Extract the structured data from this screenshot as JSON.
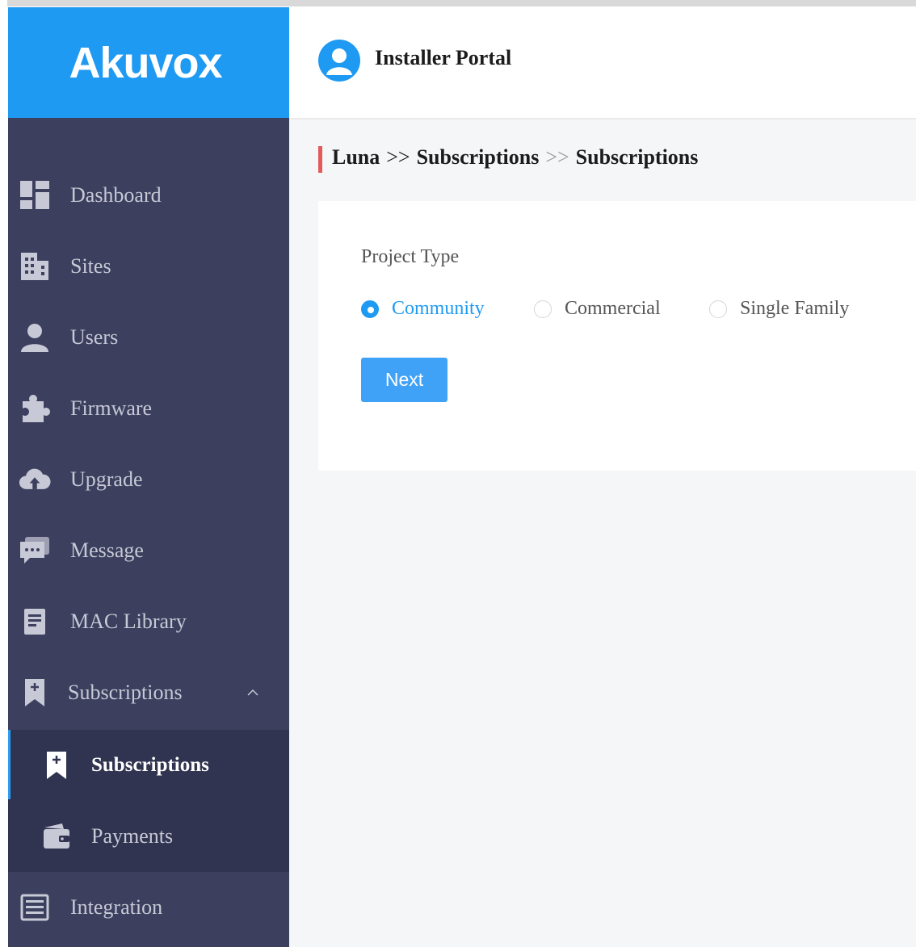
{
  "brand": {
    "logo_text": "Akuvox",
    "accent_color": "#1f9af2",
    "sidebar_color": "#3c3f5e"
  },
  "header": {
    "title": "Installer Portal",
    "avatar_icon": "user-avatar-icon"
  },
  "sidebar": {
    "items": [
      {
        "label": "Dashboard",
        "icon": "dashboard-icon"
      },
      {
        "label": "Sites",
        "icon": "building-icon"
      },
      {
        "label": "Users",
        "icon": "user-icon"
      },
      {
        "label": "Firmware",
        "icon": "puzzle-icon"
      },
      {
        "label": "Upgrade",
        "icon": "cloud-upload-icon"
      },
      {
        "label": "Message",
        "icon": "chat-icon"
      },
      {
        "label": "MAC Library",
        "icon": "document-icon"
      },
      {
        "label": "Subscriptions",
        "icon": "bookmark-plus-icon",
        "expanded": true
      },
      {
        "label": "Integration",
        "icon": "list-icon"
      }
    ],
    "subitems": [
      {
        "label": "Subscriptions",
        "icon": "bookmark-plus-icon",
        "active": true
      },
      {
        "label": "Payments",
        "icon": "wallet-icon",
        "active": false
      }
    ]
  },
  "breadcrumb": {
    "items": [
      "Luna",
      "Subscriptions",
      "Subscriptions"
    ],
    "separator": ">>"
  },
  "form": {
    "project_type_label": "Project Type",
    "options": [
      {
        "label": "Community",
        "checked": true
      },
      {
        "label": "Commercial",
        "checked": false
      },
      {
        "label": "Single Family",
        "checked": false
      }
    ],
    "next_label": "Next"
  }
}
